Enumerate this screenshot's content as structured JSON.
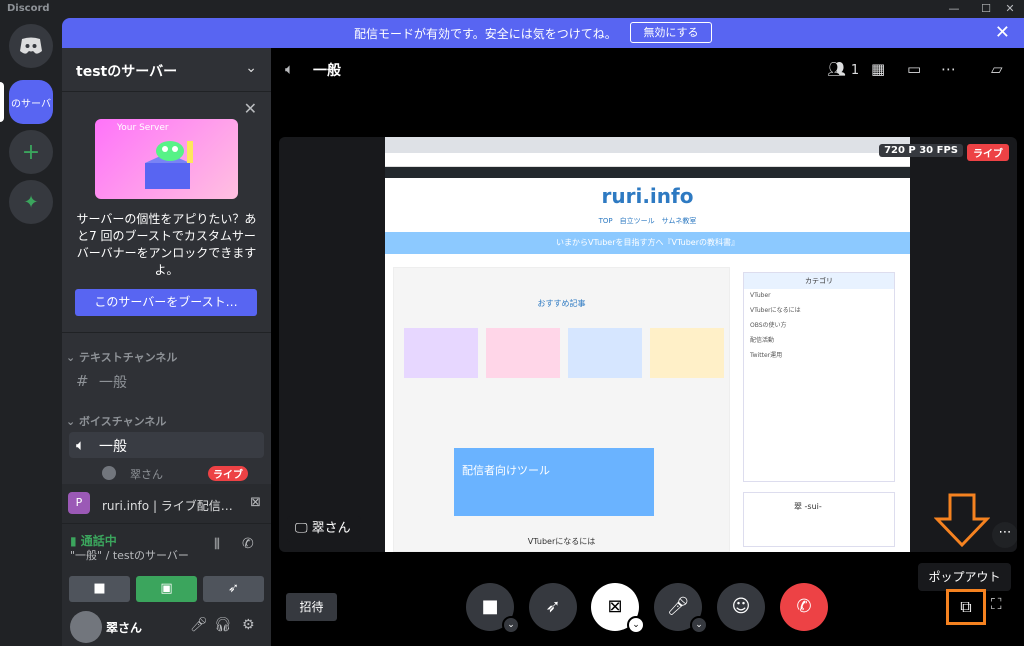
{
  "app": {
    "title": "Discord"
  },
  "banner": {
    "message": "配信モードが有効です。安全には気をつけてね。",
    "button": "無効にする"
  },
  "server": {
    "name": "testのサーバー",
    "pill": "のサーバ"
  },
  "boost": {
    "text": "サーバーの個性をアピりたい？あと7 回のブーストでカスタムサーバーバナーをアンロックできますよ。",
    "button": "このサーバーをブースト…",
    "card_title": "Your Server"
  },
  "channels": {
    "text_category": "テキストチャンネル",
    "text_channel": "一般",
    "voice_category": "ボイスチャンネル",
    "voice_channel": "一般",
    "member": "翠さん",
    "live": "ライブ"
  },
  "voice_panel": {
    "stream_title": "ruri.info | ライブ配信…",
    "stream_avatar": "P",
    "status": "通話中",
    "location": "\"一般\" / testのサーバー"
  },
  "user": {
    "name": "翠さん"
  },
  "header": {
    "channel": "一般",
    "member_count": "1"
  },
  "stream": {
    "resolution": "720 P 30 FPS",
    "live": "ライブ",
    "streamer": "翠さん"
  },
  "screen": {
    "brand": "ruri.info",
    "nav": "TOP　自立ツール　サムネ教室",
    "band": "いまからVTuberを目指す方へ『VTuberの教科書』",
    "section": "おすすめ記事",
    "sidebar_title": "カテゴリ",
    "sidebar_items": [
      "VTuber",
      "VTuberになるには",
      "OBSの使い方",
      "配信活動",
      "Twitter運用"
    ],
    "tools": "配信者向けツール",
    "bottom": "VTuberになるには",
    "profile": "翠 -sui-"
  },
  "tooltip": "ポップアウト",
  "invite": "招待"
}
